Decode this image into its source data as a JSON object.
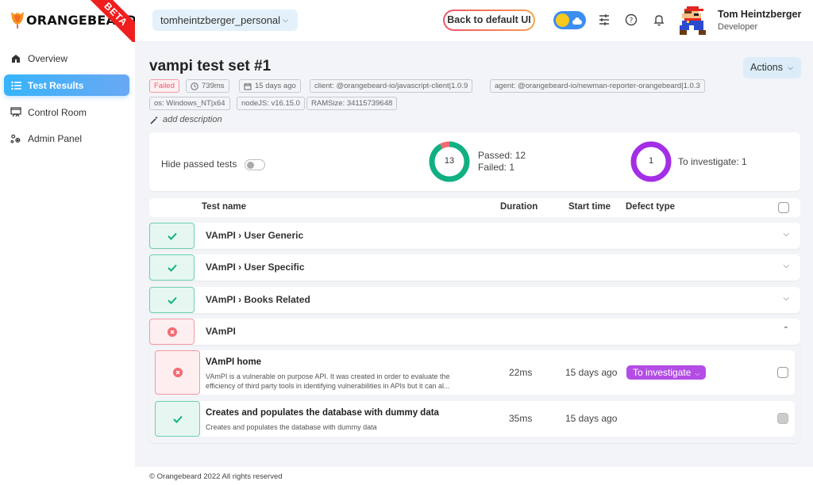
{
  "brand": {
    "name": "ORANGEBEARD",
    "badge": "BETA"
  },
  "header": {
    "workspace": "tomheintzberger_personal",
    "back_button": "Back to default UI",
    "user": {
      "name": "Tom Heintzberger",
      "role": "Developer"
    },
    "icons": [
      "theme-toggle",
      "sliders-icon",
      "help-icon",
      "bell-icon"
    ]
  },
  "sidebar": {
    "items": [
      {
        "label": "Overview",
        "icon": "home-icon",
        "active": false
      },
      {
        "label": "Test Results",
        "icon": "list-icon",
        "active": true
      },
      {
        "label": "Control Room",
        "icon": "dashboard-icon",
        "active": false
      },
      {
        "label": "Admin Panel",
        "icon": "gears-icon",
        "active": false
      }
    ]
  },
  "test_set": {
    "title": "vampi test set #1",
    "actions_label": "Actions",
    "status": "Failed",
    "duration": "739ms",
    "started": "15 days ago",
    "attributes": [
      "client: @orangebeard-io/javascript-client|1.0.9",
      "agent: @orangebeard-io/newman-reporter-orangebeard|1.0.3",
      "os: Windows_NT|x64",
      "nodeJS: v16.15.0",
      "RAMSize: 34115739648"
    ],
    "add_description": "add description"
  },
  "stats": {
    "hide_passed_label": "Hide passed tests",
    "hide_passed": false,
    "total": "13",
    "passed_label": "Passed: 12",
    "failed_label": "Failed: 1",
    "passed": 12,
    "failed": 1,
    "investigate_count": "1",
    "investigate_label": "To investigate: 1",
    "colors": {
      "passed": "#10b083",
      "failed": "#f26b73",
      "investigate": "#a32ee6"
    }
  },
  "table": {
    "headers": {
      "name": "Test name",
      "duration": "Duration",
      "start": "Start time",
      "defect": "Defect type"
    },
    "groups": [
      {
        "name": "VAmPI › User Generic",
        "status": "passed",
        "expanded": false
      },
      {
        "name": "VAmPI › User Specific",
        "status": "passed",
        "expanded": false
      },
      {
        "name": "VAmPI › Books Related",
        "status": "passed",
        "expanded": false
      },
      {
        "name": "VAmPI",
        "status": "failed",
        "expanded": true
      }
    ],
    "tests": [
      {
        "title": "VAmPI home",
        "description": "VAmPI is a vulnerable on purpose API. It was created in order to evaluate the efficiency of third party tools in identifying vulnerabilities in APIs but it can al...",
        "duration": "22ms",
        "start": "15 days ago",
        "defect": "To investigate",
        "status": "failed"
      },
      {
        "title": "Creates and populates the database with dummy data",
        "description": "Creates and populates the database with dummy data",
        "duration": "35ms",
        "start": "15 days ago",
        "defect": "",
        "status": "passed"
      }
    ]
  },
  "footer": {
    "text": "© Orangebeard 2022 All rights reserved"
  }
}
